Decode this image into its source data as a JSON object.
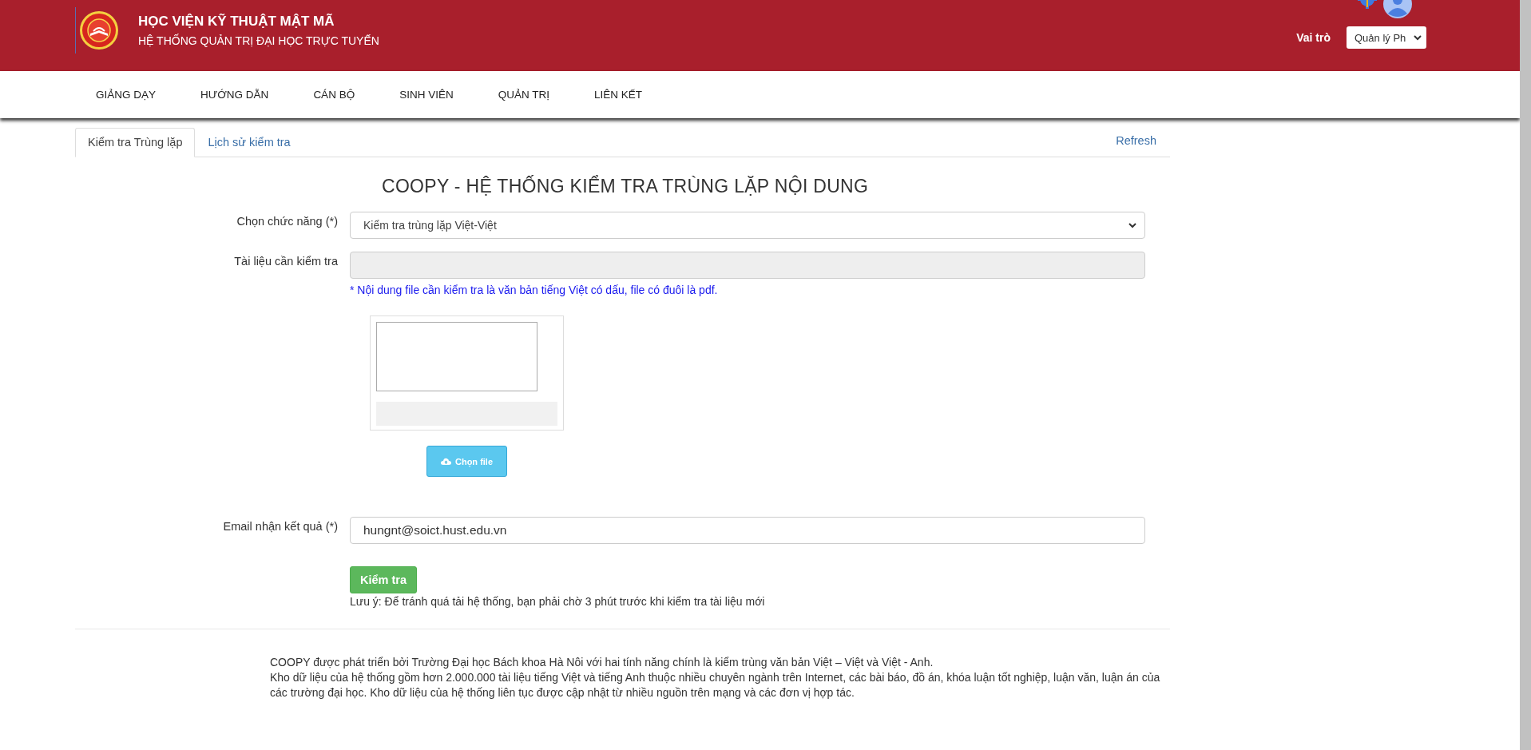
{
  "header": {
    "title": "HỌC VIỆN KỸ THUẬT MẬT MÃ",
    "subtitle": "HỆ THỐNG QUẢN TRỊ ĐẠI HỌC TRỰC TUYẾN",
    "role_label": "Vai trò",
    "role_value": "Quản lý Ph"
  },
  "nav": [
    "GIẢNG DẠY",
    "HƯỚNG DẪN",
    "CÁN BỘ",
    "SINH VIÊN",
    "QUẢN TRỊ",
    "LIÊN KẾT"
  ],
  "tabs": [
    {
      "label": "Kiểm tra Trùng lặp",
      "selected": true
    },
    {
      "label": "Lịch sử kiểm tra",
      "selected": false
    }
  ],
  "refresh": "Refresh",
  "heading": "COOPY - HỆ THỐNG KIỂM TRA TRÙNG LẶP NỘI DUNG",
  "function_field": {
    "label": "Chọn chức năng (*)",
    "value": "Kiểm tra trùng lặp Việt-Việt"
  },
  "document_field": {
    "label": "Tài liệu cần kiểm tra",
    "hint": "* Nội dung file cần kiểm tra là văn bản tiếng Việt có dấu, file có đuôi là pdf.",
    "disabled": true
  },
  "choose_file_button": "Chọn file",
  "email_field": {
    "label": "Email nhận kết quả (*)",
    "value": "hungnt@soict.hust.edu.vn"
  },
  "submit_button": "Kiểm tra",
  "notice": "Lưu ý: Để tránh quá tải hệ thống, bạn phải chờ 3 phút trước khi kiểm tra tài liệu mới",
  "about": [
    "COOPY được phát triển bởi Trường Đại học Bách khoa Hà Nôi với hai tính năng chính là kiểm trùng văn bản Việt – Việt và Việt - Anh.",
    "Kho dữ liệu của hệ thống gồm hơn 2.000.000 tài liệu tiếng Việt và tiếng Anh thuộc nhiều chuyên ngành trên Internet, các bài báo, đồ án, khóa luận tốt nghiệp, luận văn, luận án của các trường đại học. Kho dữ liệu của hệ thống liên tục được cập nhật từ nhiều nguồn trên mạng và các đơn vị hợp tác."
  ]
}
